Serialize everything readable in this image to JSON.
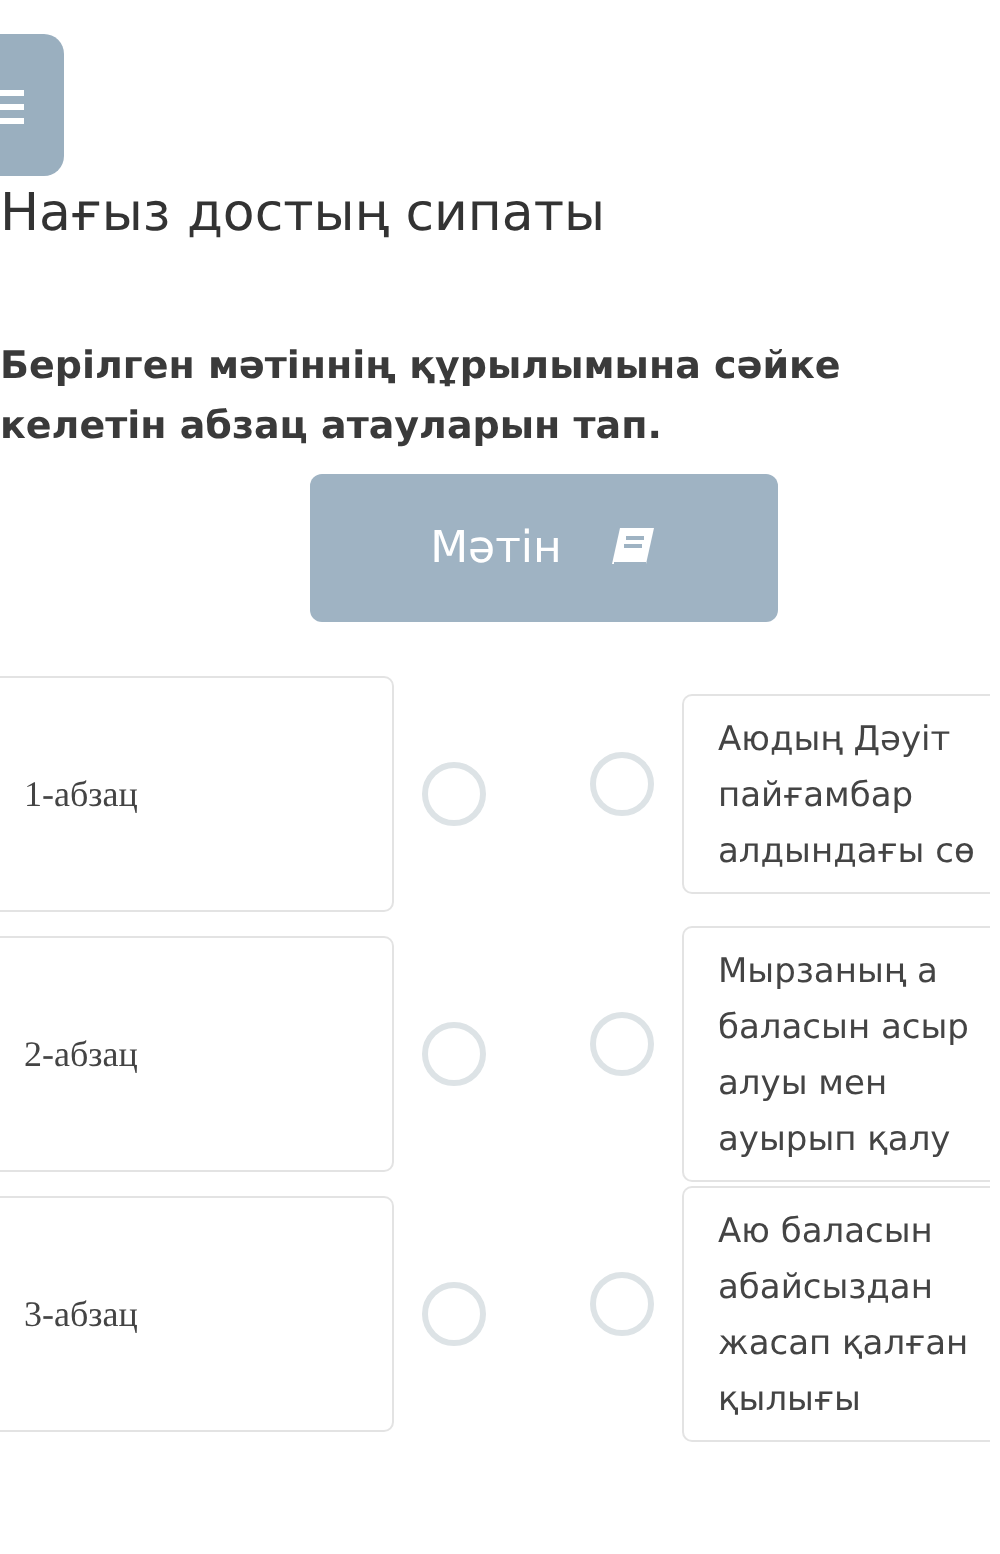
{
  "title": "Нағыз достың сипаты",
  "instruction": "Берілген мәтіннің құрылымына сәйке келетін абзац атауларын тап.",
  "text_button": {
    "label": "Мәтін"
  },
  "pairs": [
    {
      "left": {
        "label": "1-абзац",
        "selected": false
      },
      "right": {
        "label": "Аюдың Дәуіт пайғамбар алдындағы сө",
        "selected": false
      }
    },
    {
      "left": {
        "label": "2-абзац",
        "selected": false
      },
      "right": {
        "label": "Мырзаның а баласын асыр алуы мен ауырып қалу",
        "selected": false
      }
    },
    {
      "left": {
        "label": "3-абзац",
        "selected": false
      },
      "right": {
        "label": "Аю баласын абайсыздан жасап қалған қылығы",
        "selected": false
      }
    }
  ]
}
